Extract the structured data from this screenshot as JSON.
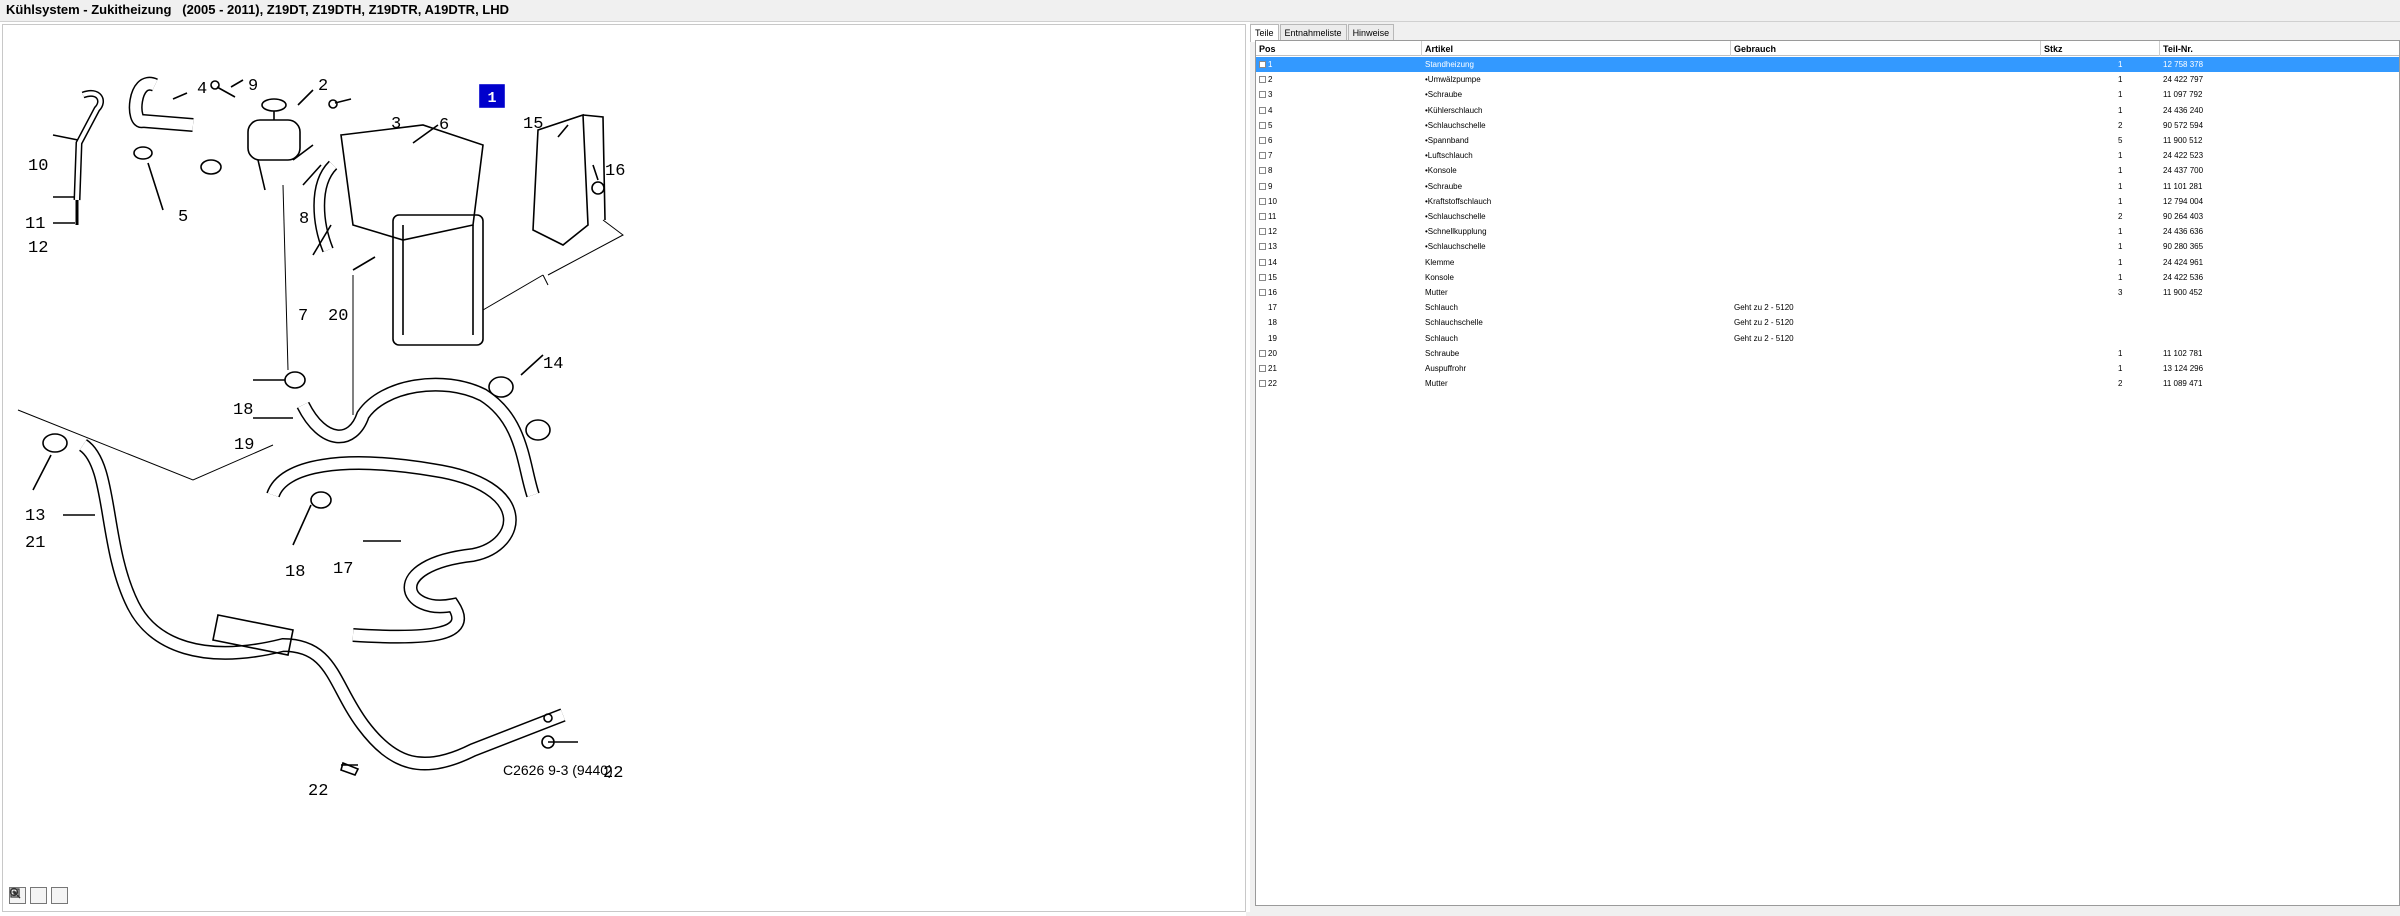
{
  "window": {
    "title": "Kühlsystem - Zukitheizung   (2005 - 2011), Z19DT, Z19DTH, Z19DTR, A19DTR, LHD"
  },
  "diagram": {
    "code": "C2626 9-3 (9440)",
    "highlight_label": "1",
    "callouts": [
      "1",
      "2",
      "3",
      "4",
      "5",
      "6",
      "7",
      "8",
      "9",
      "10",
      "11",
      "12",
      "13",
      "14",
      "15",
      "16",
      "17",
      "18",
      "18",
      "19",
      "20",
      "21",
      "22",
      "22"
    ]
  },
  "tabs": [
    "Teile",
    "Entnahmeliste",
    "Hinweise"
  ],
  "table": {
    "columns": [
      "Pos",
      "Artikel",
      "Gebrauch",
      "Stkz",
      "Teil-Nr."
    ],
    "rows": [
      {
        "pos": "1",
        "artikel": "Standheizung",
        "gebrauch": "",
        "stkz": "1",
        "teil": "12 758 378",
        "check": true
      },
      {
        "pos": "2",
        "artikel": "•Umwälzpumpe",
        "gebrauch": "",
        "stkz": "1",
        "teil": "24 422 797",
        "check": true
      },
      {
        "pos": "3",
        "artikel": "•Schraube",
        "gebrauch": "",
        "stkz": "1",
        "teil": "11 097 792",
        "check": true
      },
      {
        "pos": "4",
        "artikel": "•Kühlerschlauch",
        "gebrauch": "",
        "stkz": "1",
        "teil": "24 436 240",
        "check": true
      },
      {
        "pos": "5",
        "artikel": "•Schlauchschelle",
        "gebrauch": "",
        "stkz": "2",
        "teil": "90 572 594",
        "check": true
      },
      {
        "pos": "6",
        "artikel": "•Spannband",
        "gebrauch": "",
        "stkz": "5",
        "teil": "11 900 512",
        "check": true
      },
      {
        "pos": "7",
        "artikel": "•Luftschlauch",
        "gebrauch": "",
        "stkz": "1",
        "teil": "24 422 523",
        "check": true
      },
      {
        "pos": "8",
        "artikel": "•Konsole",
        "gebrauch": "",
        "stkz": "1",
        "teil": "24 437 700",
        "check": true
      },
      {
        "pos": "9",
        "artikel": "•Schraube",
        "gebrauch": "",
        "stkz": "1",
        "teil": "11 101 281",
        "check": true
      },
      {
        "pos": "10",
        "artikel": "•Kraftstoffschlauch",
        "gebrauch": "",
        "stkz": "1",
        "teil": "12 794 004",
        "check": true
      },
      {
        "pos": "11",
        "artikel": "•Schlauchschelle",
        "gebrauch": "",
        "stkz": "2",
        "teil": "90 264 403",
        "check": true
      },
      {
        "pos": "12",
        "artikel": "•Schnellkupplung",
        "gebrauch": "",
        "stkz": "1",
        "teil": "24 436 636",
        "check": true
      },
      {
        "pos": "13",
        "artikel": "•Schlauchschelle",
        "gebrauch": "",
        "stkz": "1",
        "teil": "90 280 365",
        "check": true
      },
      {
        "pos": "14",
        "artikel": "Klemme",
        "gebrauch": "",
        "stkz": "1",
        "teil": "24 424 961",
        "check": true
      },
      {
        "pos": "15",
        "artikel": "Konsole",
        "gebrauch": "",
        "stkz": "1",
        "teil": "24 422 536",
        "check": true
      },
      {
        "pos": "16",
        "artikel": "Mutter",
        "gebrauch": "",
        "stkz": "3",
        "teil": "11 900 452",
        "check": true
      },
      {
        "pos": "17",
        "artikel": "Schlauch",
        "gebrauch": "Geht zu 2 - 5120",
        "stkz": "",
        "teil": "",
        "check": false
      },
      {
        "pos": "18",
        "artikel": "Schlauchschelle",
        "gebrauch": "Geht zu 2 - 5120",
        "stkz": "",
        "teil": "",
        "check": false
      },
      {
        "pos": "19",
        "artikel": "Schlauch",
        "gebrauch": "Geht zu 2 - 5120",
        "stkz": "",
        "teil": "",
        "check": false
      },
      {
        "pos": "20",
        "artikel": "Schraube",
        "gebrauch": "",
        "stkz": "1",
        "teil": "11 102 781",
        "check": true
      },
      {
        "pos": "21",
        "artikel": "Auspuffrohr",
        "gebrauch": "",
        "stkz": "1",
        "teil": "13 124 296",
        "check": true
      },
      {
        "pos": "22",
        "artikel": "Mutter",
        "gebrauch": "",
        "stkz": "2",
        "teil": "11 089 471",
        "check": true
      }
    ],
    "selected_index": 0
  },
  "toolbar": {
    "icons": [
      "zoom-in-icon",
      "zoom-out-icon",
      "fit-icon"
    ]
  },
  "colors": {
    "selection": "#3399ff",
    "highlight_box": "#0000cc"
  }
}
